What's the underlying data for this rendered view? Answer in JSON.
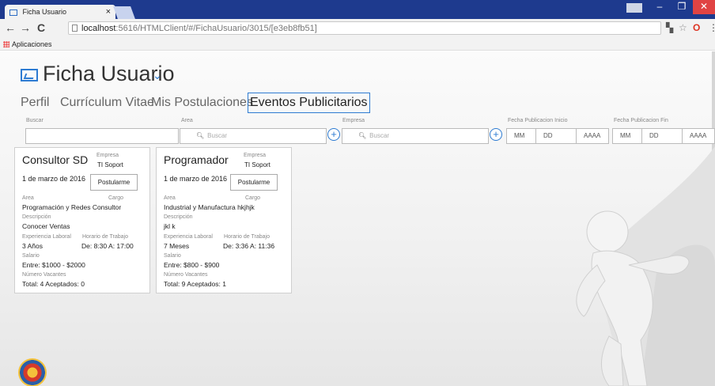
{
  "browser": {
    "tab_title": "Ficha Usuario",
    "tab_close": "×",
    "url_host": "localhost",
    "url_rest": ":5616/HTMLClient/#/FichaUsuario/3015/[e3eb8fb51]",
    "bookmarks_label": "Aplicaciones"
  },
  "page": {
    "title": "Ficha Usuario",
    "tabs": [
      "Perfil",
      "Currículum Vitae",
      "Mis Postulaciones",
      "Eventos Publicitarios"
    ],
    "active_tab": "Eventos Publicitarios"
  },
  "filters": {
    "buscar_label": "Buscar",
    "area_label": "Area",
    "area_placeholder": "Buscar",
    "empresa_label": "Empresa",
    "empresa_placeholder": "Buscar",
    "fecha_inicio_label": "Fecha Publicacion Inicio",
    "fecha_fin_label": "Fecha Publicacion Fin",
    "date_parts": [
      "MM",
      "DD",
      "AAAA"
    ]
  },
  "cards": [
    {
      "job": "Consultor SD",
      "empresa_label": "Empresa",
      "empresa": "TI Soport",
      "date": "1 de marzo de 2016",
      "button": "Postularme",
      "area_label": "Area",
      "cargo_label": "Cargo",
      "area_cargo": "Programación y Redes Consultor",
      "descripcion_label": "Descripción",
      "descripcion": "Conocer Ventas",
      "experiencia_label": "Experiencia Laboral",
      "horario_label": "Horario de Trabajo",
      "experiencia": "3 Años",
      "horario": "De: 8:30 A: 17:00",
      "salario_label": "Salario",
      "salario": "Entre: $1000 - $2000",
      "vacantes_label": "Número Vacantes",
      "vacantes": "Total: 4 Aceptados: 0"
    },
    {
      "job": "Programador",
      "empresa_label": "Empresa",
      "empresa": "TI Soport",
      "date": "1 de marzo de 2016",
      "button": "Postularme",
      "area_label": "Area",
      "cargo_label": "Cargo",
      "area_cargo": "Industrial y Manufactura hkjhjk",
      "descripcion_label": "Descripción",
      "descripcion": "jkl k",
      "experiencia_label": "Experiencia Laboral",
      "horario_label": "Horario de Trabajo",
      "experiencia": "7 Meses",
      "horario": "De: 3:36 A: 11:36",
      "salario_label": "Salario",
      "salario": "Entre: $800 - $900",
      "vacantes_label": "Número Vacantes",
      "vacantes": "Total: 9 Aceptados: 1"
    }
  ],
  "colors": {
    "accent": "#2d7bd2",
    "titlebar": "#1e3a8e"
  }
}
